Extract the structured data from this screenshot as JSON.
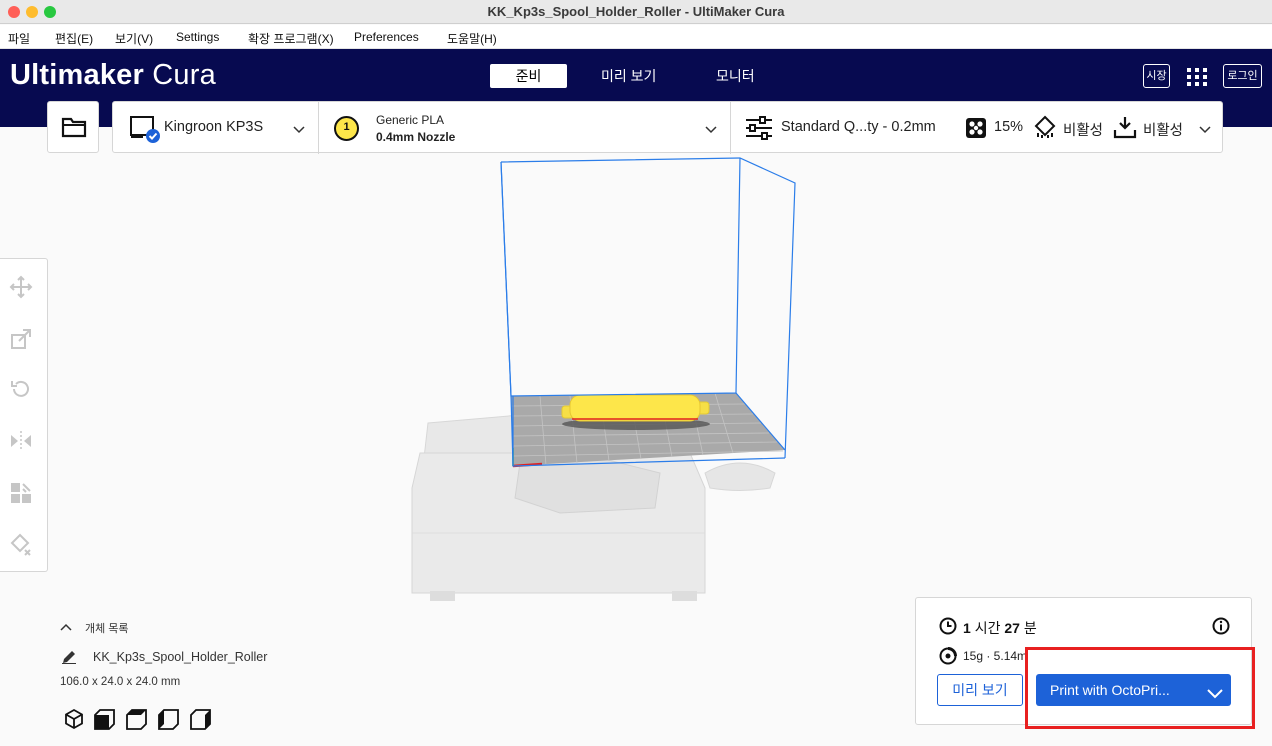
{
  "window": {
    "title": "KK_Kp3s_Spool_Holder_Roller - UltiMaker Cura"
  },
  "menu": {
    "items": [
      "파일",
      "편집(E)",
      "보기(V)",
      "Settings",
      "확장 프로그램(X)",
      "Preferences",
      "도움말(H)"
    ]
  },
  "header": {
    "logo_bold": "Ultimaker",
    "logo_light": " Cura",
    "stages": [
      "준비",
      "미리 보기",
      "모니터"
    ],
    "active_stage": "준비",
    "marketplace_label": "시장",
    "login_label": "로그인"
  },
  "toolbar": {
    "printer_name": "Kingroon KP3S",
    "extruder_number": "1",
    "material": "Generic PLA",
    "nozzle": "0.4mm Nozzle",
    "profile": "Standard Q...ty - 0.2mm",
    "infill": "15%",
    "support": "비활성",
    "adhesion": "비활성"
  },
  "left_tools": [
    "move-icon",
    "scale-icon",
    "rotate-icon",
    "mirror-icon",
    "per-model-settings-icon",
    "support-blocker-icon"
  ],
  "object_list": {
    "toggle_label": "개체 목록",
    "object_name": "KK_Kp3s_Spool_Holder_Roller",
    "dimensions": "106.0 x 24.0 x 24.0 mm",
    "view_icons": [
      "3d-view-icon",
      "front-view-icon",
      "top-view-icon",
      "left-view-icon",
      "right-view-icon"
    ]
  },
  "print_panel": {
    "time_hours": "1",
    "time_hours_unit": "시간",
    "time_minutes": "27",
    "time_minutes_unit": "분",
    "material_estimate": "15g · 5.14m",
    "preview_label": "미리 보기",
    "print_label": "Print with OctoPri..."
  },
  "colors": {
    "header_bg": "#070a50",
    "accent_blue": "#1d62d8",
    "model_yellow": "#fde64a",
    "build_volume": "#2b7de9",
    "highlight_red": "#e82020"
  }
}
